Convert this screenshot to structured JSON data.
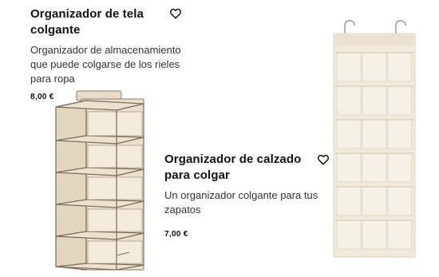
{
  "products": [
    {
      "title": "Organizador de tela colgante",
      "description": "Organizador de almacenamiento que puede colgarse de los rieles para ropa",
      "price": "8,00 €",
      "favorite_icon": "heart-outline-icon"
    },
    {
      "title": "Organizador de calzado para colgar",
      "description": "Un organizador colgante para tus zapatos",
      "price": "7,00 €",
      "favorite_icon": "heart-outline-icon"
    }
  ],
  "colors": {
    "fabric": "#efe6d4",
    "fabric_shadow": "#d9cdb5",
    "trim": "#7a6a55",
    "text": "#111111"
  }
}
